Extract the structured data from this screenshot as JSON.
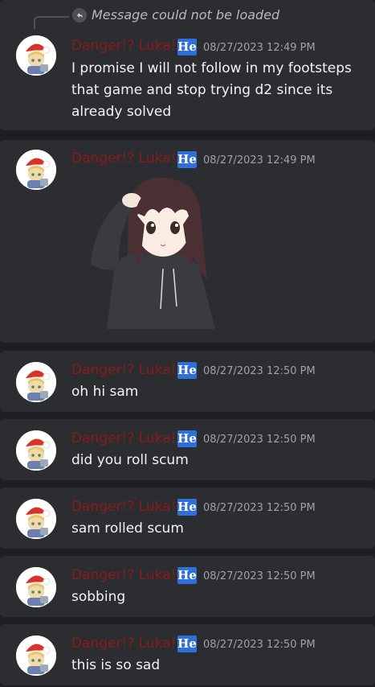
{
  "reply": {
    "text": "Message could not be loaded"
  },
  "author": {
    "name": "Danger!? Luka!",
    "tag": "He"
  },
  "messages": [
    {
      "timestamp": "08/27/2023 12:49 PM",
      "text": "I promise I will not follow in my footsteps that game and stop trying d2 since its already solved"
    },
    {
      "timestamp": "08/27/2023 12:49 PM",
      "text": ""
    },
    {
      "timestamp": "08/27/2023 12:50 PM",
      "text": "oh hi sam"
    },
    {
      "timestamp": "08/27/2023 12:50 PM",
      "text": "did you roll scum"
    },
    {
      "timestamp": "08/27/2023 12:50 PM",
      "text": "sam rolled scum"
    },
    {
      "timestamp": "08/27/2023 12:50 PM",
      "text": "sobbing"
    },
    {
      "timestamp": "08/27/2023 12:50 PM",
      "text": "this is so sad"
    }
  ],
  "colors": {
    "background": "#1e1f22",
    "message_bg": "#2b2d31",
    "author": "#8b1a1a",
    "tag": "#2f6fdb",
    "timestamp": "#9ea1a7",
    "text": "#f2f3f5"
  }
}
